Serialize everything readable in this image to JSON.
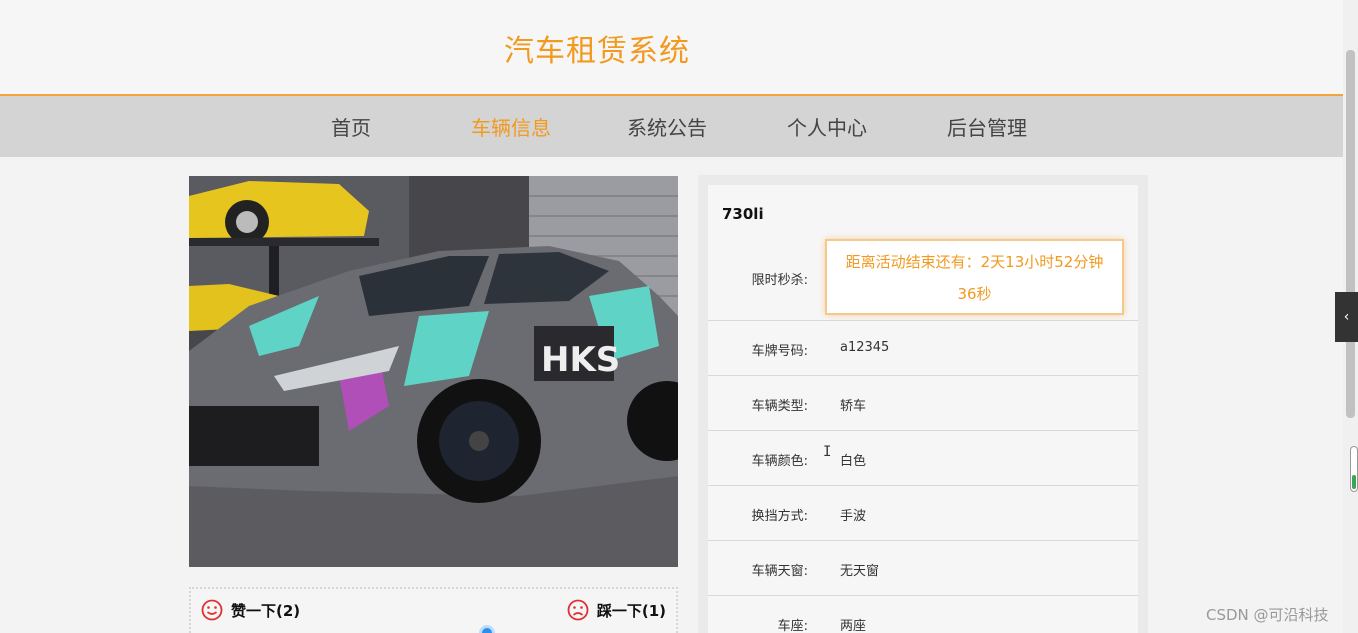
{
  "header": {
    "title": "汽车租赁系统"
  },
  "nav": {
    "items": [
      {
        "label": "首页",
        "active": false
      },
      {
        "label": "车辆信息",
        "active": true
      },
      {
        "label": "系统公告",
        "active": false
      },
      {
        "label": "个人中心",
        "active": false
      },
      {
        "label": "后台管理",
        "active": false
      }
    ]
  },
  "vote": {
    "like_label": "赞一下(2)",
    "dislike_label": "踩一下(1)",
    "like_icon": "smile-face-icon",
    "dislike_icon": "sad-face-icon"
  },
  "car": {
    "name": "730li",
    "flash_sale_label": "限时秒杀:",
    "countdown_line1": "距离活动结束还有：2天13小时52分钟",
    "countdown_line2": "36秒",
    "fields": [
      {
        "label": "车牌号码:",
        "value": "a12345"
      },
      {
        "label": "车辆类型:",
        "value": "轿车"
      },
      {
        "label": "车辆颜色:",
        "value": "白色"
      },
      {
        "label": "换挡方式:",
        "value": "手波"
      },
      {
        "label": "车辆天窗:",
        "value": "无天窗"
      },
      {
        "label": "车座:",
        "value": "两座"
      }
    ]
  },
  "watermark": "CSDN @可沿科技",
  "colors": {
    "accent": "#f29a1f",
    "nav_bg": "#d4d4d4"
  }
}
